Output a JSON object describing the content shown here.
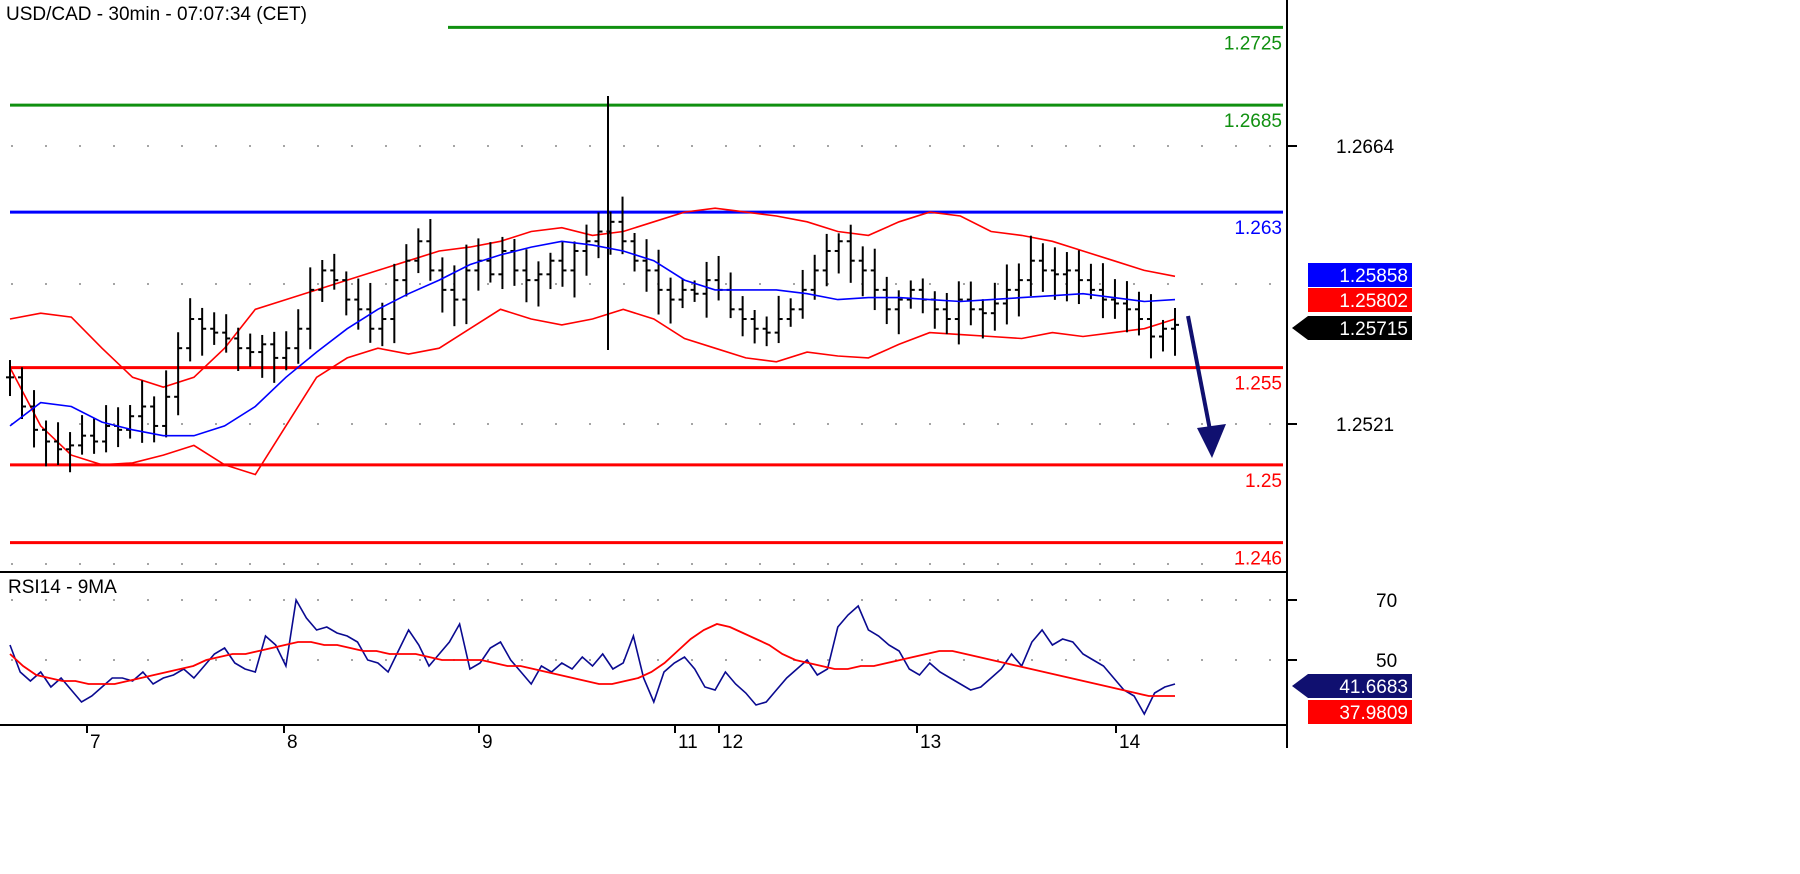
{
  "title": "USD/CAD - 30min - 07:07:34 (CET)",
  "rsi_title": "RSI14 - 9MA",
  "colors": {
    "candle": "#000000",
    "bollinger": "#ff0000",
    "ma": "#0000ff",
    "support": "#ff0000",
    "resistance_green": "#109010",
    "resistance_blue": "#0000ff",
    "rsi_line": "#0a0a90",
    "rsi_ma": "#ff0000",
    "arrow": "#101070"
  },
  "chart_data": [
    {
      "type": "line",
      "name": "price",
      "ylim": [
        1.245,
        1.2745
      ],
      "yticks": [
        "1.2664",
        "1.2521"
      ],
      "x_tick_labels": [
        "7",
        "8",
        "9",
        "11",
        "12",
        "13",
        "14"
      ],
      "horizontal_levels": [
        {
          "value": 1.2725,
          "label": "1.2725",
          "color": "#109010"
        },
        {
          "value": 1.2685,
          "label": "1.2685",
          "color": "#109010"
        },
        {
          "value": 1.263,
          "label": "1.263",
          "color": "#0000ff"
        },
        {
          "value": 1.255,
          "label": "1.255",
          "color": "#ff0000"
        },
        {
          "value": 1.25,
          "label": "1.25",
          "color": "#ff0000"
        },
        {
          "value": 1.246,
          "label": "1.246",
          "color": "#ff0000"
        }
      ],
      "price_tags": [
        {
          "value": 1.25858,
          "label": "1.25858",
          "bg": "#0000ff"
        },
        {
          "value": 1.25802,
          "label": "1.25802",
          "bg": "#ff0000"
        },
        {
          "value": 1.25715,
          "label": "1.25715",
          "bg": "#000000"
        }
      ],
      "close_series": [
        1.2545,
        1.253,
        1.2518,
        1.2512,
        1.2508,
        1.251,
        1.2515,
        1.2512,
        1.252,
        1.2518,
        1.2525,
        1.253,
        1.252,
        1.2535,
        1.256,
        1.2575,
        1.257,
        1.2568,
        1.2565,
        1.256,
        1.2558,
        1.2562,
        1.2555,
        1.256,
        1.257,
        1.259,
        1.26,
        1.2595,
        1.2585,
        1.258,
        1.257,
        1.2575,
        1.2595,
        1.2605,
        1.2615,
        1.26,
        1.259,
        1.2585,
        1.26,
        1.2605,
        1.2598,
        1.261,
        1.26,
        1.2595,
        1.2598,
        1.2605,
        1.26,
        1.261,
        1.2615,
        1.262,
        1.2625,
        1.2615,
        1.2605,
        1.26,
        1.259,
        1.2585,
        1.259,
        1.2588,
        1.2595,
        1.259,
        1.258,
        1.2575,
        1.257,
        1.2568,
        1.2575,
        1.258,
        1.259,
        1.26,
        1.261,
        1.2615,
        1.2605,
        1.26,
        1.259,
        1.258,
        1.2585,
        1.259,
        1.2585,
        1.258,
        1.2575,
        1.2585,
        1.258,
        1.2578,
        1.2583,
        1.259,
        1.2595,
        1.2605,
        1.26,
        1.2598,
        1.26,
        1.2595,
        1.259,
        1.2585,
        1.2583,
        1.258,
        1.2575,
        1.2566,
        1.257,
        1.2572
      ],
      "bb_upper": [
        1.2575,
        1.2578,
        1.2576,
        1.256,
        1.2545,
        1.254,
        1.2545,
        1.256,
        1.258,
        1.2585,
        1.259,
        1.2595,
        1.26,
        1.2605,
        1.261,
        1.2612,
        1.2615,
        1.262,
        1.2622,
        1.2618,
        1.262,
        1.2625,
        1.263,
        1.2632,
        1.263,
        1.2628,
        1.2625,
        1.262,
        1.2618,
        1.2625,
        1.263,
        1.2628,
        1.262,
        1.2618,
        1.2615,
        1.261,
        1.2605,
        1.26,
        1.2597
      ],
      "bb_lower": [
        1.255,
        1.252,
        1.2505,
        1.25,
        1.2501,
        1.2505,
        1.251,
        1.25,
        1.2495,
        1.252,
        1.2545,
        1.2555,
        1.256,
        1.2557,
        1.256,
        1.257,
        1.258,
        1.2575,
        1.2572,
        1.2575,
        1.258,
        1.2575,
        1.2565,
        1.256,
        1.2555,
        1.2553,
        1.2558,
        1.2556,
        1.2555,
        1.2562,
        1.2568,
        1.2567,
        1.2566,
        1.2565,
        1.2568,
        1.2566,
        1.2568,
        1.257,
        1.2575
      ],
      "ma_series": [
        1.252,
        1.2532,
        1.253,
        1.2522,
        1.2518,
        1.2515,
        1.2515,
        1.252,
        1.253,
        1.2545,
        1.2558,
        1.257,
        1.258,
        1.2588,
        1.2595,
        1.2603,
        1.2608,
        1.2612,
        1.2615,
        1.2613,
        1.261,
        1.2605,
        1.2595,
        1.259,
        1.259,
        1.259,
        1.2588,
        1.2585,
        1.2586,
        1.2586,
        1.2585,
        1.2584,
        1.2585,
        1.2586,
        1.2587,
        1.2588,
        1.2586,
        1.2584,
        1.2585
      ]
    },
    {
      "type": "line",
      "name": "RSI14 - 9MA",
      "ylim": [
        30,
        76
      ],
      "yticks": [
        "70",
        "50"
      ],
      "rsi_tags": [
        {
          "value": 41.6683,
          "label": "41.6683",
          "bg": "#101070"
        },
        {
          "value": 37.9809,
          "label": "37.9809",
          "bg": "#ff0000"
        }
      ],
      "rsi_series": [
        55,
        46,
        43,
        46,
        41,
        44,
        40,
        36,
        38,
        41,
        44,
        44,
        43,
        46,
        42,
        44,
        45,
        47,
        44,
        48,
        52,
        54,
        49,
        47,
        46,
        58,
        55,
        48,
        70,
        64,
        60,
        61,
        59,
        58,
        56,
        50,
        49,
        46,
        53,
        60,
        55,
        48,
        52,
        56,
        62,
        47,
        49,
        54,
        56,
        50,
        46,
        42,
        48,
        46,
        49,
        47,
        51,
        48,
        52,
        47,
        49,
        58,
        44,
        36,
        46,
        49,
        51,
        47,
        41,
        40,
        46,
        42,
        39,
        35,
        36,
        40,
        44,
        47,
        50,
        45,
        47,
        61,
        65,
        68,
        60,
        58,
        55,
        53,
        47,
        45,
        49,
        46,
        44,
        42,
        40,
        41,
        44,
        47,
        52,
        48,
        56,
        60,
        55,
        57,
        56,
        52,
        50,
        48,
        44,
        40,
        38,
        32,
        39,
        41,
        42
      ],
      "rsi_ma_series": [
        52,
        48,
        45,
        44,
        43,
        43,
        42,
        42,
        42,
        43,
        44,
        45,
        46,
        47,
        48,
        50,
        51,
        52,
        52,
        53,
        54,
        55,
        56,
        56,
        55,
        55,
        54,
        53,
        53,
        52,
        52,
        52,
        51,
        50,
        50,
        50,
        50,
        49,
        48,
        48,
        47,
        46,
        45,
        44,
        43,
        42,
        42,
        43,
        44,
        46,
        49,
        53,
        57,
        60,
        62,
        61,
        59,
        57,
        55,
        52,
        50,
        49,
        48,
        47,
        47,
        48,
        48,
        49,
        50,
        51,
        52,
        53,
        53,
        52,
        51,
        50,
        49,
        48,
        47,
        46,
        45,
        44,
        43,
        42,
        41,
        40,
        39,
        38,
        38,
        38
      ]
    }
  ]
}
